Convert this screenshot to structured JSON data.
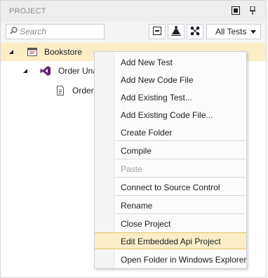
{
  "header": {
    "title": "PROJECT"
  },
  "toolbar": {
    "search_placeholder": "Search",
    "filter_value": "All Tests"
  },
  "tree": {
    "root": {
      "label": "Bookstore"
    },
    "child": {
      "label": "Order Una"
    },
    "grandchild": {
      "label": "Order"
    }
  },
  "context_menu": {
    "items": [
      "Add New Test",
      "Add New Code File",
      "Add Existing Test...",
      "Add Existing Code File...",
      "Create Folder",
      "Compile",
      "Paste",
      "Connect to Source Control",
      "Rename",
      "Close Project",
      "Edit Embedded Api Project",
      "Open Folder in Windows Explorer"
    ],
    "disabled": [
      "Paste"
    ],
    "highlighted": "Edit Embedded Api Project"
  },
  "colors": {
    "selection": "#fbeec7",
    "selection_border": "#e5c365",
    "vs_purple": "#68217a",
    "bookstore_icon": "#c0504d"
  }
}
